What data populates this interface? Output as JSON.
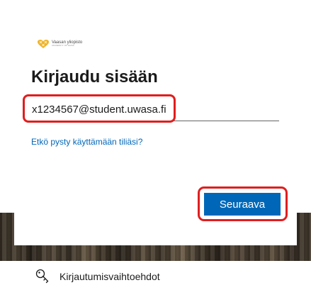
{
  "branding": {
    "name": "Vaasan yliopisto",
    "subtitle": "UNIVERSITY OF VAASA",
    "brand_color": "#f0b429"
  },
  "signin": {
    "title": "Kirjaudu sisään",
    "email_value": "x1234567@student.uwasa.fi",
    "help_link": "Etkö pysty käyttämään tiliäsi?",
    "next_button": "Seuraava"
  },
  "options": {
    "label": "Kirjautumisvaihtoehdot",
    "icon": "key-icon"
  },
  "colors": {
    "accent": "#0067b8",
    "annotation": "#e01e1e"
  }
}
